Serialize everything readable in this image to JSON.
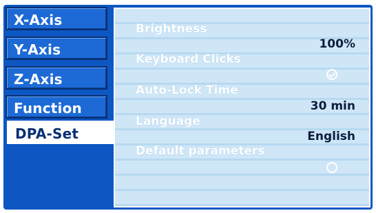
{
  "sidebar": {
    "items": [
      {
        "label": "X-Axis"
      },
      {
        "label": "Y-Axis"
      },
      {
        "label": "Z-Axis"
      },
      {
        "label": "Function"
      },
      {
        "label": "DPA-Set",
        "active": true
      }
    ]
  },
  "settings": {
    "brightness": {
      "label": "Brightness",
      "value": "100%"
    },
    "keyboard_clicks": {
      "label": "Keyboard Clicks",
      "checked": true
    },
    "auto_lock": {
      "label": "Auto-Lock Time",
      "value": "30 min"
    },
    "language": {
      "label": "Language",
      "value": "English"
    },
    "default_parameters": {
      "label": "Default parameters",
      "checked": false
    }
  },
  "colors": {
    "background": "#0d57c2",
    "panel": "#cfe6f7",
    "label_text": "#ffffff",
    "value_text": "#0b1e40"
  }
}
